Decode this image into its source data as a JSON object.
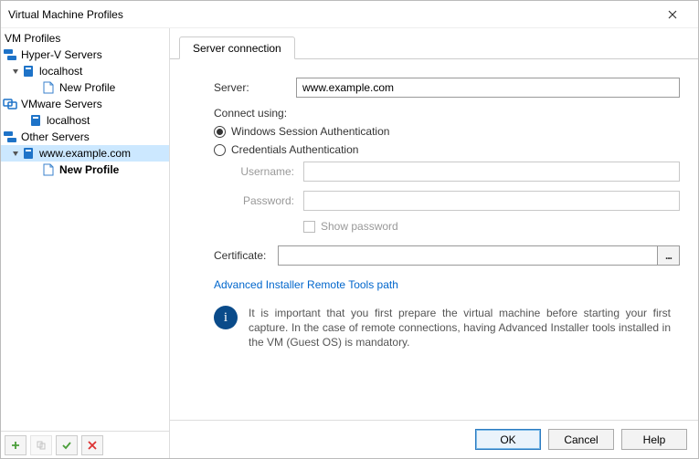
{
  "window": {
    "title": "Virtual Machine Profiles"
  },
  "tree": {
    "vm_profiles": "VM Profiles",
    "hyperv": "Hyper-V Servers",
    "hyperv_localhost": "localhost",
    "hyperv_newprofile": "New Profile",
    "vmware": "VMware Servers",
    "vmware_localhost": "localhost",
    "other": "Other Servers",
    "other_host": "www.example.com",
    "other_newprofile": "New Profile"
  },
  "tab": {
    "server_connection": "Server connection"
  },
  "form": {
    "server_label": "Server:",
    "server_value": "www.example.com",
    "connect_using": "Connect using:",
    "radio_wsa": "Windows Session Authentication",
    "radio_cred": "Credentials Authentication",
    "username_label": "Username:",
    "password_label": "Password:",
    "show_password": "Show password",
    "certificate_label": "Certificate:",
    "cert_browse": "...",
    "remote_link": "Advanced Installer Remote Tools path",
    "info_text": "It is important that you first prepare the virtual machine before starting your first capture. In the case of remote connections, having Advanced Installer tools installed in the VM (Guest OS) is mandatory."
  },
  "buttons": {
    "ok": "OK",
    "cancel": "Cancel",
    "help": "Help"
  }
}
